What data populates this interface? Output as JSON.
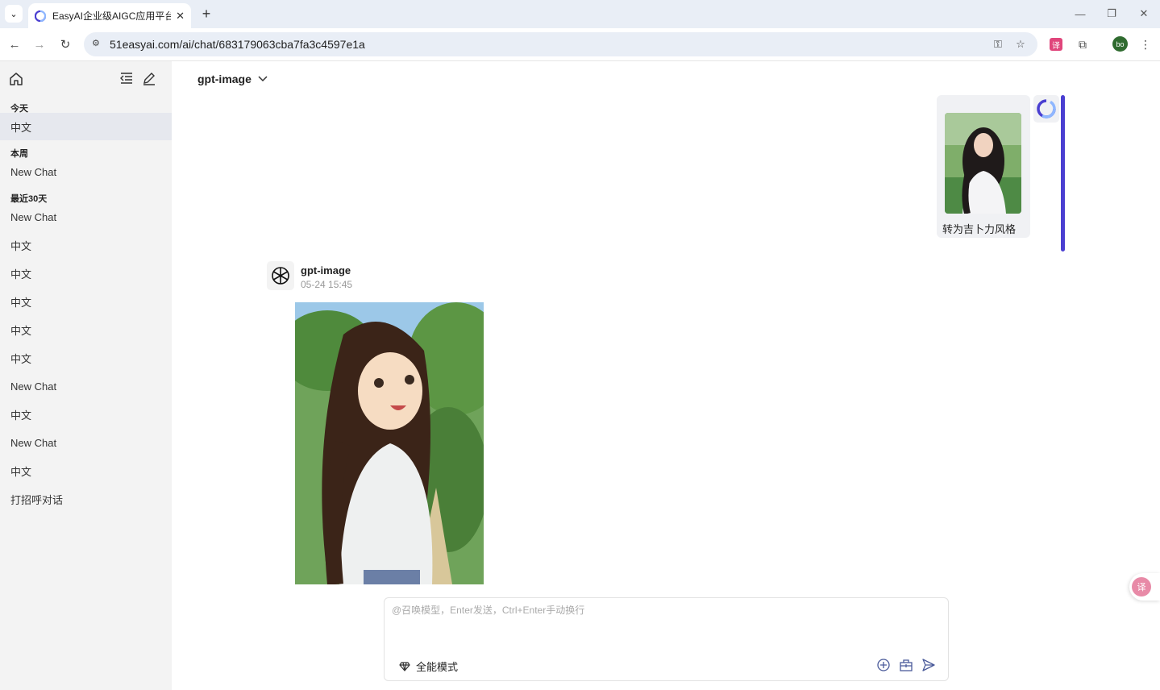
{
  "browser": {
    "tab_title": "EasyAI企业级AIGC应用平台-轻",
    "url": "51easyai.com/ai/chat/683179063cba7fa3c4597e1a",
    "profile_initials": "bo",
    "translate_ext_label": "译"
  },
  "sidebar": {
    "sections": [
      {
        "label": "今天",
        "items": [
          "中文"
        ]
      },
      {
        "label": "本周",
        "items": [
          "New Chat"
        ]
      },
      {
        "label": "最近30天",
        "items": [
          "New Chat",
          "中文",
          "中文",
          "中文",
          "中文",
          "中文",
          "New Chat",
          "中文",
          "New Chat",
          "中文",
          "打招呼对话"
        ]
      }
    ]
  },
  "main": {
    "model_name": "gpt-image",
    "user_message": {
      "text": "转为吉卜力风格"
    },
    "bot_message": {
      "name": "gpt-image",
      "time": "05-24 15:45"
    },
    "composer": {
      "placeholder": "@召唤模型，Enter发送，Ctrl+Enter手动换行",
      "mode_label": "全能模式"
    }
  },
  "colors": {
    "accent": "#4a3fd1",
    "sidebar_bg": "#f3f3f3",
    "active_item": "#e6e8ee"
  },
  "float_translate_label": "译"
}
